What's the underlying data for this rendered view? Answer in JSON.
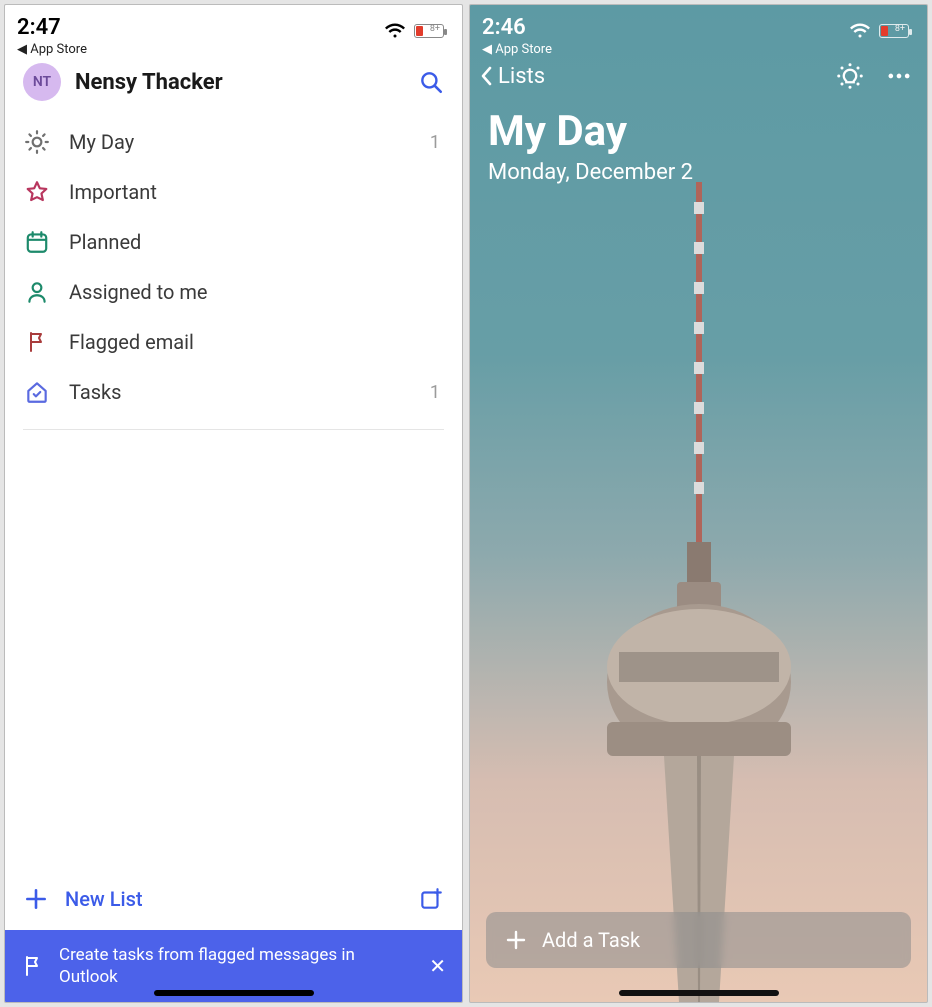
{
  "left": {
    "status": {
      "time": "2:47",
      "back_app": "App Store",
      "battery_text": "8+"
    },
    "user": {
      "initials": "NT",
      "name": "Nensy Thacker"
    },
    "lists": [
      {
        "icon": "sun",
        "label": "My Day",
        "count": "1"
      },
      {
        "icon": "star",
        "label": "Important",
        "count": ""
      },
      {
        "icon": "calendar",
        "label": "Planned",
        "count": ""
      },
      {
        "icon": "person",
        "label": "Assigned to me",
        "count": ""
      },
      {
        "icon": "flag",
        "label": "Flagged email",
        "count": ""
      },
      {
        "icon": "home",
        "label": "Tasks",
        "count": "1"
      }
    ],
    "new_list_label": "New List",
    "banner_text": "Create tasks from flagged messages in Outlook"
  },
  "right": {
    "status": {
      "time": "2:46",
      "back_app": "App Store",
      "battery_text": "8+"
    },
    "back_label": "Lists",
    "title": "My Day",
    "subtitle": "Monday, December 2",
    "add_task_label": "Add a Task"
  }
}
